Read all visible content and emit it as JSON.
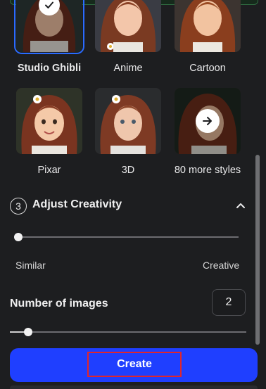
{
  "styles": [
    {
      "label": "Studio Ghibli",
      "selected": true,
      "badge": "check-icon"
    },
    {
      "label": "Anime",
      "selected": false
    },
    {
      "label": "Cartoon",
      "selected": false
    },
    {
      "label": "Pixar",
      "selected": false
    },
    {
      "label": "3D",
      "selected": false
    },
    {
      "label": "80 more styles",
      "selected": false,
      "badge": "arrow-right-icon"
    }
  ],
  "creativity": {
    "step": "3",
    "title": "Adjust Creativity",
    "collapse_icon": "chevron-up-icon",
    "min_label": "Similar",
    "max_label": "Creative",
    "value_fraction": 0.0
  },
  "images": {
    "title": "Number of images",
    "value": "2",
    "slider_fraction": 0.06
  },
  "create_button": {
    "label": "Create"
  },
  "colors": {
    "accent": "#1f3fff",
    "highlight_box": "#e0262c",
    "selected_outline": "#2a6bff",
    "background": "#1d1e20"
  }
}
